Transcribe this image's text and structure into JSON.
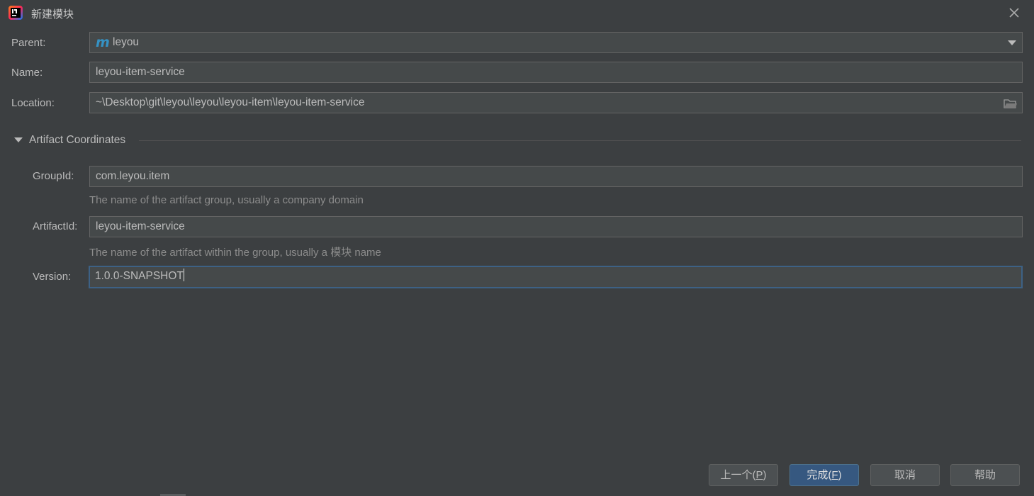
{
  "window": {
    "title": "新建模块"
  },
  "form": {
    "parent": {
      "label": "Parent:",
      "value": "leyou"
    },
    "name": {
      "label": "Name:",
      "value": "leyou-item-service"
    },
    "location": {
      "label": "Location:",
      "value": "~\\Desktop\\git\\leyou\\leyou\\leyou-item\\leyou-item-service"
    }
  },
  "artifact": {
    "section_title": "Artifact Coordinates",
    "group_id": {
      "label": "GroupId:",
      "value": "com.leyou.item",
      "hint": "The name of the artifact group, usually a company domain"
    },
    "artifact_id": {
      "label": "ArtifactId:",
      "value": "leyou-item-service",
      "hint": "The name of the artifact within the group, usually a 模块 name"
    },
    "version": {
      "label": "Version:",
      "value": "1.0.0-SNAPSHOT"
    }
  },
  "buttons": {
    "previous": {
      "text": "上一个(",
      "mnemonic": "P",
      "suffix": ")"
    },
    "finish": {
      "text": "完成(",
      "mnemonic": "F",
      "suffix": ")"
    },
    "cancel": "取消",
    "help": "帮助"
  },
  "icons": {
    "app": "intellij-idea-icon",
    "close": "close-icon",
    "maven": "maven-module-icon",
    "dropdown": "chevron-down-icon",
    "folder": "folder-icon",
    "toggle": "triangle-down-icon"
  },
  "colors": {
    "background": "#3c3f41",
    "field": "#45494a",
    "focus_border": "#3d6185",
    "primary_button": "#365880"
  }
}
